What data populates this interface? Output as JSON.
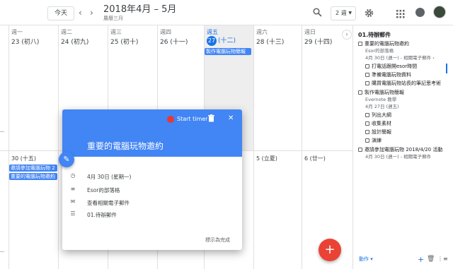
{
  "topbar": {
    "today_label": "今天",
    "prev_icon": "chevron-left-icon",
    "next_icon": "chevron-right-icon",
    "date_range": "2018年4月 – 5月",
    "lunar_month": "農曆三月",
    "view_label": "2 週",
    "search_icon": "search-icon",
    "settings_icon": "gear-icon",
    "apps_icon": "grid-icon"
  },
  "week1": {
    "days": [
      {
        "name": "週一",
        "date": "23 (初八)"
      },
      {
        "name": "週二",
        "date": "24 (初九)"
      },
      {
        "name": "週三",
        "date": "25 (初十)"
      },
      {
        "name": "週四",
        "date": "26 (十一)"
      },
      {
        "name": "週五",
        "num": "27",
        "lunar": "(十二)"
      },
      {
        "name": "週六",
        "date": "28 (十三)"
      },
      {
        "name": "週日",
        "date": "29 (十四)"
      }
    ],
    "friday_event": "製作電腦玩物簡報"
  },
  "week2": {
    "mon_date": "30 (十五)",
    "sat_date": "5 (立夏)",
    "sun_date": "6 (廿一)",
    "events": [
      "邀請參加電腦玩物 2",
      "重要的電腦玩物邀約"
    ]
  },
  "popup": {
    "timer_label": "Start timer",
    "title": "重要的電腦玩物邀約",
    "date": "4月 30日 (星期一)",
    "source": "Esor的部落格",
    "email_link": "查看相關電子郵件",
    "list_name": "01.待辦郵件",
    "mark_done": "標示為完成"
  },
  "tasks_panel": {
    "title": "01.待辦郵件",
    "items": [
      {
        "text": "重要的電腦玩物邀約",
        "sub": "Esor的部落格",
        "meta": "4月 30日 (週一) - 相關電子郵件 ›"
      },
      {
        "text": "打電話跟開esor時間"
      },
      {
        "text": "準備電腦玩物資料"
      },
      {
        "text": "購買電腦玩物站長的筆記思考術"
      },
      {
        "text": "製作電腦玩物簡報",
        "sub": "Evernote 教學",
        "meta": "4月 27日 (週五)"
      },
      {
        "text": "列出大綱"
      },
      {
        "text": "收集素材"
      },
      {
        "text": "設計簡報"
      },
      {
        "text": "演練"
      },
      {
        "text": "邀請參加電腦玩物 2018/4/20 活動",
        "meta": "4月 30日 (週一) - 相關電子郵件"
      }
    ],
    "footer_link": "動作 ▾"
  },
  "colors": {
    "accent": "#4285f4",
    "fab": "#ea4335",
    "today_bg": "#eeeeee"
  }
}
